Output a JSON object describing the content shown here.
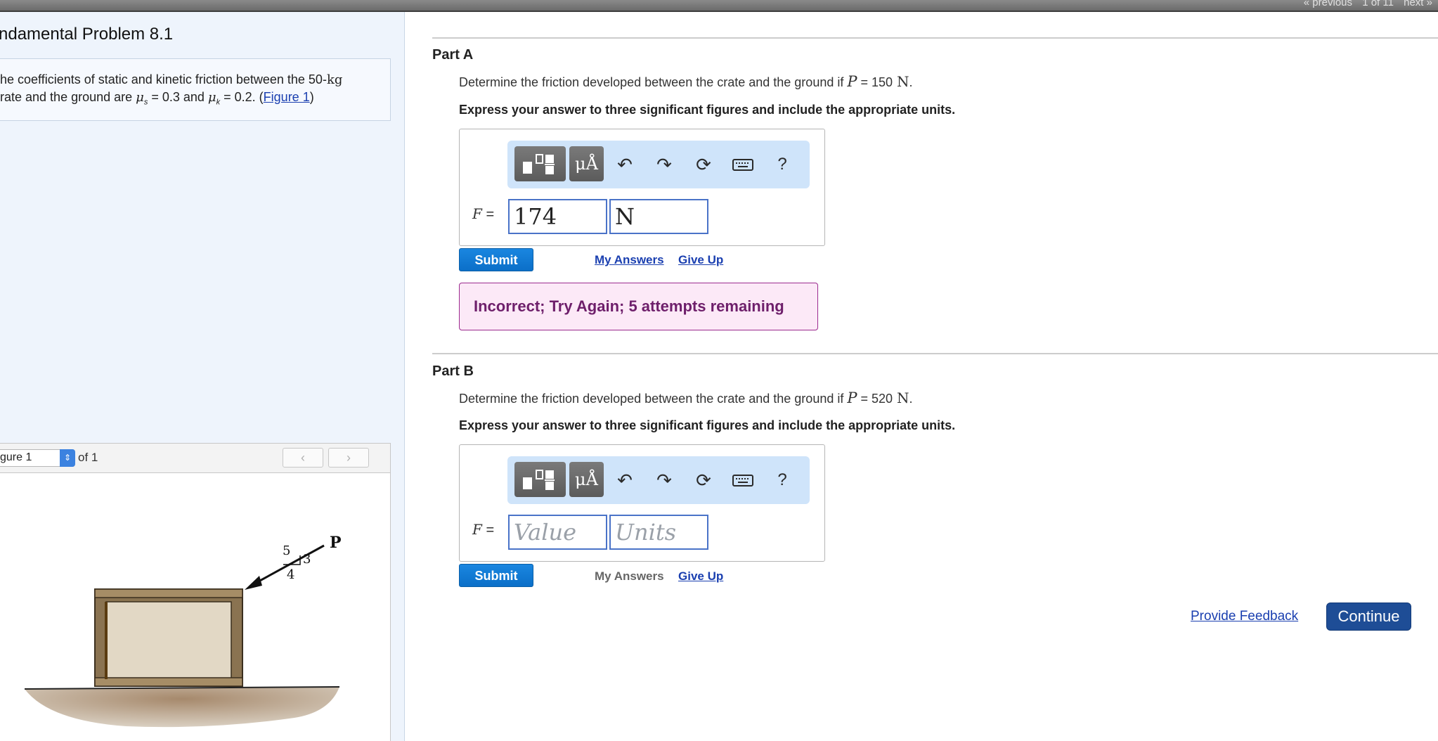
{
  "topnav": {
    "previous": "« previous",
    "position": "1 of 11",
    "next": "next »"
  },
  "problem": {
    "title": "ndamental Problem 8.1",
    "line1_a": "he coefficients of static and kinetic friction between the 50-",
    "line1_kg": "kg",
    "line2_a": "rate and the ground are ",
    "mu_s": "μ",
    "mu_s_sub": "s",
    "mu_s_val": " = 0.3 and ",
    "mu_k": "μ",
    "mu_k_sub": "k",
    "mu_k_val": " = 0.2. (",
    "figure_link": "Figure 1",
    "close_paren": ")"
  },
  "figure": {
    "select_value": "gure 1",
    "of_label": "of 1",
    "prev_icon": "chevron-left-icon",
    "next_icon": "chevron-right-icon",
    "prev_glyph": "‹",
    "next_glyph": "›",
    "label_P": "P",
    "label_5": "5",
    "label_3": "3",
    "label_4": "4"
  },
  "partA": {
    "label": "Part A",
    "question": "Determine the friction developed between the crate and the ground if ",
    "var": "P",
    "value": " = 150",
    "unit": "N",
    "period": ".",
    "instruction": "Express your answer to three significant figures and include the appropriate units.",
    "f_label_var": "F",
    "f_label_eq": " =",
    "value_input": "174",
    "unit_input": "N",
    "submit": "Submit",
    "my_answers": "My Answers",
    "give_up": "Give Up",
    "feedback": "Incorrect; Try Again; 5 attempts remaining"
  },
  "partB": {
    "label": "Part B",
    "question": "Determine the friction developed between the crate and the ground if ",
    "var": "P",
    "value": " = 520",
    "unit": "N",
    "period": ".",
    "instruction": "Express your answer to three significant figures and include the appropriate units.",
    "f_label_var": "F",
    "f_label_eq": " =",
    "value_placeholder": "Value",
    "unit_placeholder": "Units",
    "submit": "Submit",
    "my_answers": "My Answers",
    "give_up": "Give Up"
  },
  "toolbar": {
    "mu_a_label": "μÅ",
    "help": "?",
    "icons": [
      "templates-icon",
      "units-icon",
      "undo-icon",
      "redo-icon",
      "reset-icon",
      "keyboard-icon",
      "help-icon"
    ]
  },
  "footer": {
    "provide_feedback": "Provide Feedback",
    "continue": "Continue"
  },
  "colors": {
    "accent": "#0b6fc8",
    "continue": "#1e4d96",
    "error_text": "#6e1f6b",
    "error_bg": "#fce9f7"
  }
}
